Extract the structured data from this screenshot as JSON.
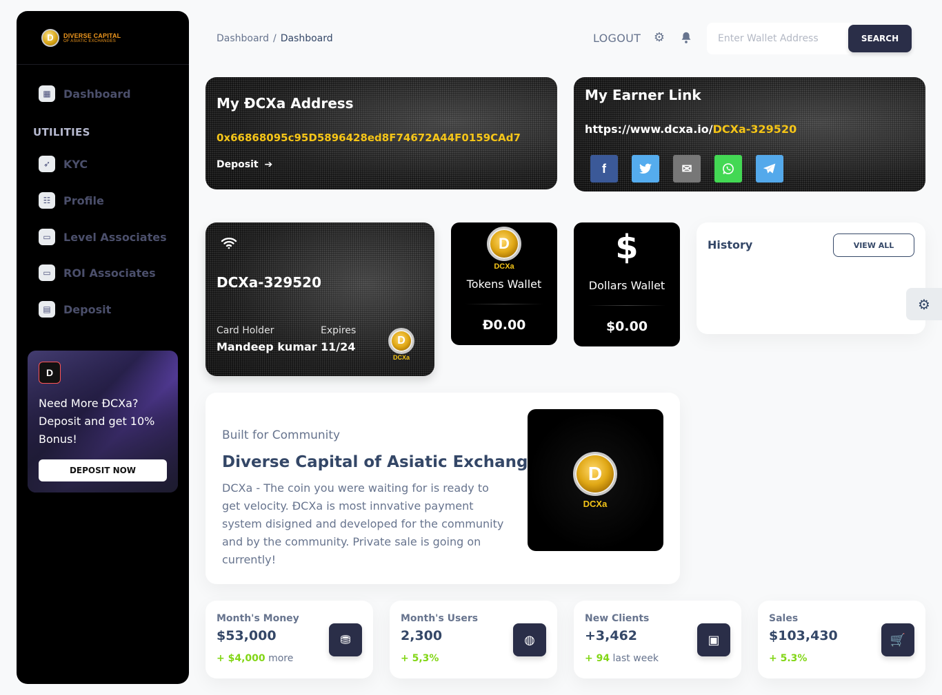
{
  "brand": {
    "line1": "DIVERSE CAPITAL",
    "line2": "OF ASIATIC EXCHANGES",
    "logo_letter": "D"
  },
  "sidebar": {
    "items": [
      {
        "label": "Dashboard",
        "icon": "shop-icon"
      },
      {
        "label": "KYC",
        "icon": "rocket-icon"
      },
      {
        "label": "Profile",
        "icon": "user-card-icon"
      },
      {
        "label": "Level Associates",
        "icon": "monitor-icon"
      },
      {
        "label": "ROI Associates",
        "icon": "monitor-icon"
      },
      {
        "label": "Deposit",
        "icon": "credit-card-icon"
      }
    ],
    "section_title": "UTILITIES",
    "promo": {
      "text": "Need More ĐCXa? Deposit and get 10% Bonus!",
      "button": "DEPOSIT NOW",
      "icon_letter": "D"
    }
  },
  "topbar": {
    "breadcrumb": [
      "Dashboard",
      "Dashboard"
    ],
    "breadcrumb_sep": "/",
    "logout": "LOGOUT",
    "search": {
      "placeholder": "Enter Wallet Address",
      "value": "",
      "button": "SEARCH"
    }
  },
  "address_card": {
    "title": "My ĐCXa Address",
    "address": "0x66868095c95D5896428ed8F74672A44F0159CAd7",
    "deposit_label": "Deposit",
    "deposit_arrow": "➔"
  },
  "earner_card": {
    "title": "My Earner Link",
    "url_base": "https://www.dcxa.io/",
    "url_code": "DCXa-329520",
    "share": [
      {
        "name": "facebook",
        "glyph": "f",
        "color": "#3b5998"
      },
      {
        "name": "twitter",
        "glyph": "🐦",
        "color": "#55acee"
      },
      {
        "name": "email",
        "glyph": "✉",
        "color": "#777777"
      },
      {
        "name": "whatsapp",
        "glyph": "✆",
        "color": "#43d854"
      },
      {
        "name": "telegram",
        "glyph": "➤",
        "color": "#54a9eb"
      }
    ]
  },
  "id_card": {
    "number": "DCXa-329520",
    "holder_label": "Card Holder",
    "holder": "Mandeep kumar",
    "expires_label": "Expires",
    "expires": "11/24",
    "coin_letter": "D",
    "coin_label": "DCXa"
  },
  "wallets": [
    {
      "title": "Tokens Wallet",
      "value": "Đ0.00",
      "icon": "dcxa-coin",
      "coin_letter": "D",
      "coin_label": "DCXa"
    },
    {
      "title": "Dollars Wallet",
      "value": "$0.00",
      "icon": "dollar-icon",
      "glyph": "$"
    }
  ],
  "history": {
    "title": "History",
    "button": "VIEW ALL"
  },
  "community": {
    "eyebrow": "Built for Community",
    "title": "Diverse Capital of Asiatic Exchanges",
    "body": "DCXa - The coin you were waiting for is ready to get velocity. ĐCXa is most innvative payment system disigned and developed for the community and by the community. Private sale is going on currently!",
    "coin_letter": "D",
    "coin_label": "DCXa"
  },
  "stats": [
    {
      "label": "Month's Money",
      "value": "$53,000",
      "change": "+ $4,000",
      "suffix": "more",
      "icon": "money-coins-icon",
      "glyph": "⛃"
    },
    {
      "label": "Month's Users",
      "value": "2,300",
      "change": "+ 5,3%",
      "suffix": "",
      "icon": "world-icon",
      "glyph": "◍"
    },
    {
      "label": "New Clients",
      "value": "+3,462",
      "change": "+ 94",
      "suffix": "last week",
      "icon": "contact-card-icon",
      "glyph": "▣"
    },
    {
      "label": "Sales",
      "value": "$103,430",
      "change": "+ 5.3%",
      "suffix": "",
      "icon": "cart-icon",
      "glyph": "🛒"
    }
  ]
}
